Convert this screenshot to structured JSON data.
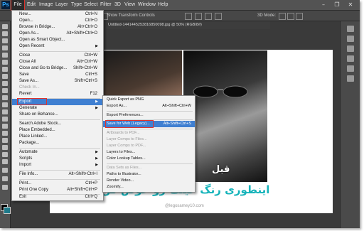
{
  "menubar": {
    "logo": "Ps",
    "items": [
      "File",
      "Edit",
      "Image",
      "Layer",
      "Type",
      "Select",
      "Filter",
      "3D",
      "View",
      "Window",
      "Help"
    ],
    "window_controls": [
      "–",
      "❐",
      "✕"
    ]
  },
  "options_bar": {
    "show_transform": "Show Transform Controls",
    "mode_3d": "3D Mode:"
  },
  "document": {
    "tab_title": "Untitled-1441445253816850098.jpg @ 50% (RGB/8#)",
    "caption_before": "قبل",
    "caption_main": "اینطوری رنگ عینک رو عوض کن",
    "watermark": "@legosamey10.com"
  },
  "file_menu": {
    "items": [
      {
        "label": "New...",
        "shortcut": "Ctrl+N"
      },
      {
        "label": "Open...",
        "shortcut": "Ctrl+O"
      },
      {
        "label": "Browse in Bridge...",
        "shortcut": "Alt+Ctrl+O"
      },
      {
        "label": "Open As...",
        "shortcut": "Alt+Shift+Ctrl+O"
      },
      {
        "label": "Open as Smart Object...",
        "shortcut": ""
      },
      {
        "label": "Open Recent",
        "shortcut": "",
        "submenu": true
      },
      {
        "label": "Close",
        "shortcut": "Ctrl+W"
      },
      {
        "label": "Close All",
        "shortcut": "Alt+Ctrl+W"
      },
      {
        "label": "Close and Go to Bridge...",
        "shortcut": "Shift+Ctrl+W"
      },
      {
        "label": "Save",
        "shortcut": "Ctrl+S"
      },
      {
        "label": "Save As...",
        "shortcut": "Shift+Ctrl+S"
      },
      {
        "label": "Check In...",
        "shortcut": "",
        "disabled": true
      },
      {
        "label": "Revert",
        "shortcut": "F12"
      },
      {
        "label": "Export",
        "shortcut": "",
        "submenu": true,
        "highlighted": true
      },
      {
        "label": "Generate",
        "shortcut": "",
        "submenu": true
      },
      {
        "label": "Share on Behance...",
        "shortcut": ""
      },
      {
        "label": "Search Adobe Stock...",
        "shortcut": ""
      },
      {
        "label": "Place Embedded...",
        "shortcut": ""
      },
      {
        "label": "Place Linked...",
        "shortcut": ""
      },
      {
        "label": "Package...",
        "shortcut": ""
      },
      {
        "label": "Automate",
        "shortcut": "",
        "submenu": true
      },
      {
        "label": "Scripts",
        "shortcut": "",
        "submenu": true
      },
      {
        "label": "Import",
        "shortcut": "",
        "submenu": true
      },
      {
        "label": "File Info...",
        "shortcut": "Alt+Shift+Ctrl+I"
      },
      {
        "label": "Print...",
        "shortcut": "Ctrl+P"
      },
      {
        "label": "Print One Copy",
        "shortcut": "Alt+Shift+Ctrl+P"
      },
      {
        "label": "Exit",
        "shortcut": "Ctrl+Q"
      }
    ]
  },
  "export_submenu": {
    "items": [
      {
        "label": "Quick Export as PNG",
        "shortcut": ""
      },
      {
        "label": "Export As...",
        "shortcut": "Alt+Shift+Ctrl+W"
      },
      {
        "label": "Export Preferences...",
        "shortcut": ""
      },
      {
        "label": "Save for Web (Legacy)...",
        "shortcut": "Alt+Shift+Ctrl+S",
        "highlighted": true
      },
      {
        "label": "Artboards to PDF...",
        "shortcut": "",
        "disabled": true
      },
      {
        "label": "Layer Comps to Files...",
        "shortcut": "",
        "disabled": true
      },
      {
        "label": "Layer Comps to PDF...",
        "shortcut": "",
        "disabled": true
      },
      {
        "label": "Layers to Files...",
        "shortcut": ""
      },
      {
        "label": "Color Lookup Tables...",
        "shortcut": ""
      },
      {
        "label": "Data Sets as Files...",
        "shortcut": "",
        "disabled": true
      },
      {
        "label": "Paths to Illustrator...",
        "shortcut": ""
      },
      {
        "label": "Render Video...",
        "shortcut": ""
      },
      {
        "label": "Zoomify...",
        "shortcut": ""
      }
    ]
  },
  "colors": {
    "highlight": "#3f7fd1",
    "annotation": "#e0342c",
    "caption_teal": "#15b3ba"
  }
}
